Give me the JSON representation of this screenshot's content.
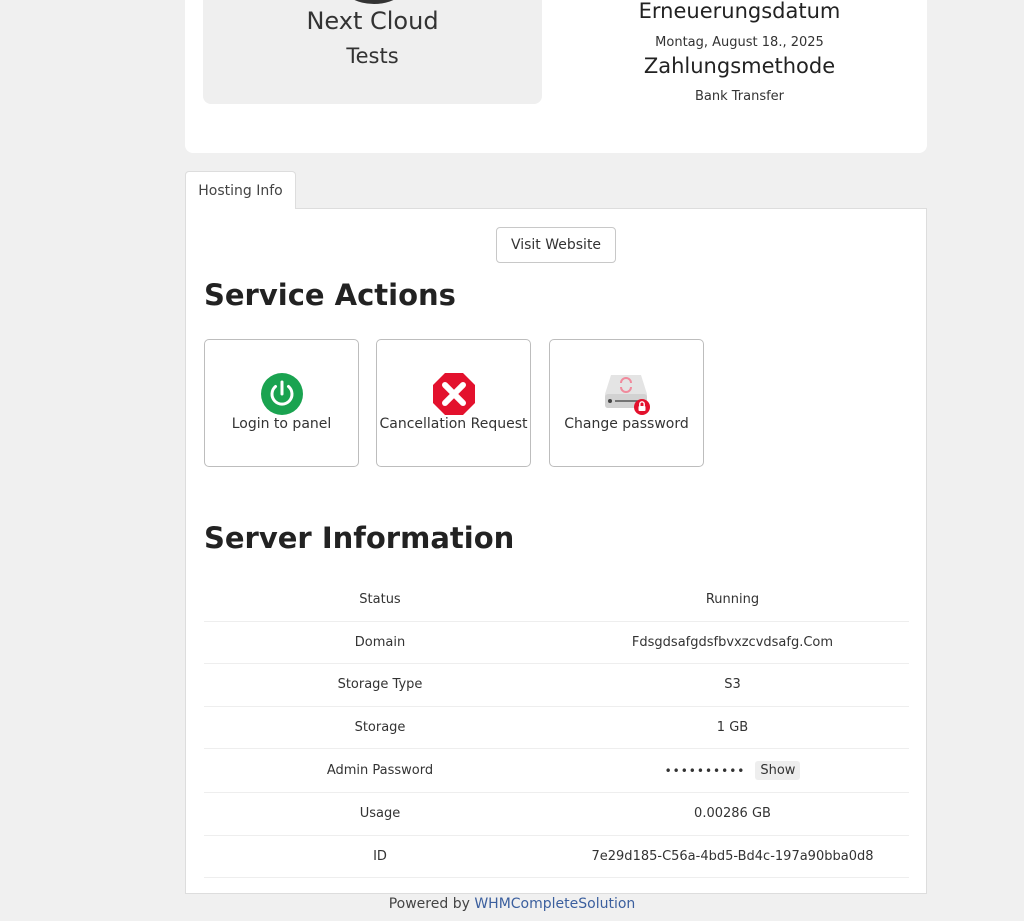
{
  "product": {
    "name": "Next Cloud",
    "group": "Tests",
    "renewal_label": "Erneuerungsdatum",
    "renewal_date": "Montag, August 18., 2025",
    "payment_label": "Zahlungsmethode",
    "payment_method": "Bank Transfer"
  },
  "tabs": [
    {
      "label": "Hosting Info",
      "active": true
    }
  ],
  "visit_website_label": "Visit Website",
  "service_actions": {
    "title": "Service Actions",
    "items": [
      {
        "label": "Login to panel",
        "icon": "power-icon",
        "color": "#1aa350"
      },
      {
        "label": "Cancellation Request",
        "icon": "cancel-stop-icon",
        "color": "#e3112d"
      },
      {
        "label": "Change password",
        "icon": "drive-lock-icon",
        "color": "#e3112d"
      }
    ]
  },
  "server_info": {
    "title": "Server Information",
    "rows": [
      {
        "key": "Status",
        "value": "Running"
      },
      {
        "key": "Domain",
        "value": "Fdsgdsafgdsfbvxzcvdsafg.Com"
      },
      {
        "key": "Storage Type",
        "value": "S3"
      },
      {
        "key": "Storage",
        "value": "1 GB"
      },
      {
        "key": "Admin Password",
        "value": "••••••••••",
        "show_label": "Show"
      },
      {
        "key": "Usage",
        "value": "0.00286 GB"
      },
      {
        "key": "ID",
        "value": "7e29d185-C56a-4bd5-Bd4c-197a90bba0d8"
      }
    ]
  },
  "footer": {
    "prefix": "Powered by",
    "link": "WHMCompleteSolution"
  }
}
